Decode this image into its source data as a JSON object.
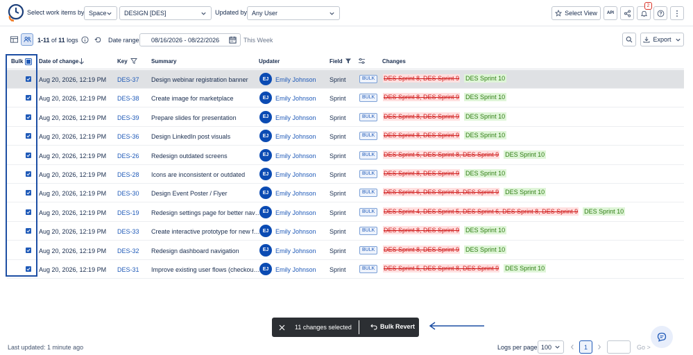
{
  "toolbar": {
    "select_label": "Select work items by:",
    "space_label": "Space",
    "space_value": "DESIGN [DES]",
    "updated_by_label": "Updated by:",
    "updated_by_value": "Any User",
    "select_view": "Select View",
    "api_label": "API",
    "notifications_count": "2"
  },
  "subbar": {
    "range_bold": "1-11",
    "range_of": "of",
    "total_bold": "11",
    "logs_word": "logs",
    "date_range_label": "Date range:",
    "date_range_value": "08/16/2026 - 08/22/2026",
    "this_week": "This Week",
    "export_label": "Export"
  },
  "table": {
    "columns": [
      "Bulk",
      "Date of change",
      "Key",
      "Summary",
      "Updater",
      "Field",
      "Changes"
    ],
    "rows": [
      {
        "date": "Aug 20, 2026, 12:19 PM",
        "key": "DES-37",
        "summary": "Design webinar registration banner",
        "initials": "EJ",
        "updater": "Emily Johnson",
        "field": "Sprint",
        "badge": "BULK",
        "old": "DES Sprint 8, DES Sprint 9",
        "new": "DES Sprint 10"
      },
      {
        "date": "Aug 20, 2026, 12:19 PM",
        "key": "DES-38",
        "summary": "Create image for marketplace",
        "initials": "EJ",
        "updater": "Emily Johnson",
        "field": "Sprint",
        "badge": "BULK",
        "old": "DES Sprint 8, DES Sprint 9",
        "new": "DES Sprint 10"
      },
      {
        "date": "Aug 20, 2026, 12:19 PM",
        "key": "DES-39",
        "summary": "Prepare slides for presentation",
        "initials": "EJ",
        "updater": "Emily Johnson",
        "field": "Sprint",
        "badge": "BULK",
        "old": "DES Sprint 8, DES Sprint 9",
        "new": "DES Sprint 10"
      },
      {
        "date": "Aug 20, 2026, 12:19 PM",
        "key": "DES-36",
        "summary": "Design LinkedIn post visuals",
        "initials": "EJ",
        "updater": "Emily Johnson",
        "field": "Sprint",
        "badge": "BULK",
        "old": "DES Sprint 8, DES Sprint 9",
        "new": "DES Sprint 10"
      },
      {
        "date": "Aug 20, 2026, 12:19 PM",
        "key": "DES-26",
        "summary": "Redesign outdated screens",
        "initials": "EJ",
        "updater": "Emily Johnson",
        "field": "Sprint",
        "badge": "BULK",
        "old": "DES Sprint 6, DES Sprint 8, DES Sprint 9",
        "new": "DES Sprint 10"
      },
      {
        "date": "Aug 20, 2026, 12:19 PM",
        "key": "DES-28",
        "summary": "Icons are inconsistent or outdated",
        "initials": "EJ",
        "updater": "Emily Johnson",
        "field": "Sprint",
        "badge": "BULK",
        "old": "DES Sprint 8, DES Sprint 9",
        "new": "DES Sprint 10"
      },
      {
        "date": "Aug 20, 2026, 12:19 PM",
        "key": "DES-30",
        "summary": "Design Event Poster / Flyer",
        "initials": "EJ",
        "updater": "Emily Johnson",
        "field": "Sprint",
        "badge": "BULK",
        "old": "DES Sprint 6, DES Sprint 8, DES Sprint 9",
        "new": "DES Sprint 10"
      },
      {
        "date": "Aug 20, 2026, 12:19 PM",
        "key": "DES-19",
        "summary": "Redesign settings page for better nav…",
        "initials": "EJ",
        "updater": "Emily Johnson",
        "field": "Sprint",
        "badge": "BULK",
        "old": "DES Sprint 4, DES Sprint 5, DES Sprint 6, DES Sprint 8, DES Sprint 9",
        "new": "DES Sprint 10"
      },
      {
        "date": "Aug 20, 2026, 12:19 PM",
        "key": "DES-33",
        "summary": "Create interactive prototype for new f…",
        "initials": "EJ",
        "updater": "Emily Johnson",
        "field": "Sprint",
        "badge": "BULK",
        "old": "DES Sprint 8, DES Sprint 9",
        "new": "DES Sprint 10"
      },
      {
        "date": "Aug 20, 2026, 12:19 PM",
        "key": "DES-32",
        "summary": "Redesign dashboard navigation",
        "initials": "EJ",
        "updater": "Emily Johnson",
        "field": "Sprint",
        "badge": "BULK",
        "old": "DES Sprint 8, DES Sprint 9",
        "new": "DES Sprint 10"
      },
      {
        "date": "Aug 20, 2026, 12:19 PM",
        "key": "DES-31",
        "summary": "Improve existing user flows (checkou…",
        "initials": "EJ",
        "updater": "Emily Johnson",
        "field": "Sprint",
        "badge": "BULK",
        "old": "DES Sprint 5, DES Sprint 8, DES Sprint 9",
        "new": "DES Sprint 10"
      }
    ]
  },
  "snackbar": {
    "selected_text": "11 changes selected",
    "revert_label": "Bulk Revert"
  },
  "footer": {
    "last_updated": "Last updated: 1 minute ago",
    "logs_per_page_label": "Logs per page:",
    "logs_per_page_value": "100",
    "current_page": "1",
    "go_label": "Go >"
  },
  "colors": {
    "accent": "#1f5ab8",
    "avatar": "#0b4bb3",
    "highlight_frame": "#1c4ea3",
    "old_value": "#d01c1c",
    "new_value": "#2e7d12"
  }
}
